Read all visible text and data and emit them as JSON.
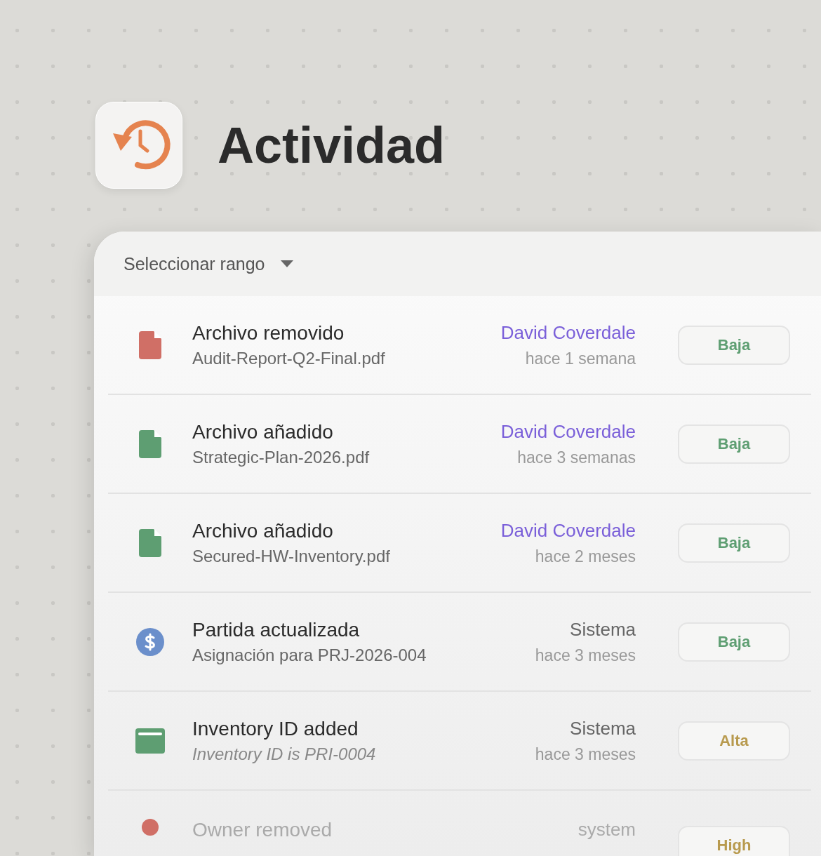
{
  "header": {
    "title": "Actividad"
  },
  "filter": {
    "label": "Seleccionar rango"
  },
  "activities": [
    {
      "icon": {
        "kind": "file",
        "color": "#d06f66"
      },
      "title": "Archivo removido",
      "detail": "Audit-Report-Q2-Final.pdf",
      "italic": false,
      "actor": {
        "name": "David Coverdale",
        "kind": "user"
      },
      "time": "hace 1 semana",
      "priority": {
        "label": "Baja",
        "kind": "low"
      }
    },
    {
      "icon": {
        "kind": "file",
        "color": "#5e9e72"
      },
      "title": "Archivo añadido",
      "detail": "Strategic-Plan-2026.pdf",
      "italic": false,
      "actor": {
        "name": "David Coverdale",
        "kind": "user"
      },
      "time": "hace 3 semanas",
      "priority": {
        "label": "Baja",
        "kind": "low"
      }
    },
    {
      "icon": {
        "kind": "file",
        "color": "#5e9e72"
      },
      "title": "Archivo añadido",
      "detail": "Secured-HW-Inventory.pdf",
      "italic": false,
      "actor": {
        "name": "David Coverdale",
        "kind": "user"
      },
      "time": "hace 2 meses",
      "priority": {
        "label": "Baja",
        "kind": "low"
      }
    },
    {
      "icon": {
        "kind": "dollar",
        "color": "#6b8fcb"
      },
      "title": "Partida actualizada",
      "detail": "Asignación para PRJ-2026-004",
      "italic": false,
      "actor": {
        "name": "Sistema",
        "kind": "system"
      },
      "time": "hace 3 meses",
      "priority": {
        "label": "Baja",
        "kind": "low"
      }
    },
    {
      "icon": {
        "kind": "card",
        "color": "#5e9e72"
      },
      "title": "Inventory ID added",
      "detail": "Inventory ID is PRI-0004",
      "italic": true,
      "actor": {
        "name": "Sistema",
        "kind": "system"
      },
      "time": "hace 3 meses",
      "priority": {
        "label": "Alta",
        "kind": "high"
      }
    },
    {
      "icon": {
        "kind": "dot",
        "color": "#d06f66"
      },
      "title": "Owner removed",
      "actor": {
        "name": "system",
        "kind": "system"
      },
      "priority": {
        "label": "High",
        "kind": "high"
      }
    }
  ]
}
